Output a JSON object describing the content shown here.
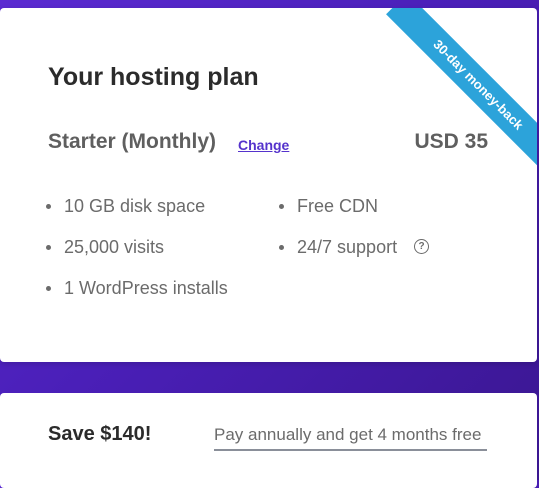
{
  "plan_card": {
    "ribbon_text": "30-day money-back",
    "title": "Your hosting plan",
    "plan_name": "Starter (Monthly)",
    "change_label": "Change",
    "price": "USD 35",
    "features_col1": [
      "10 GB disk space",
      "25,000 visits",
      "1 WordPress installs"
    ],
    "features_col2": [
      "Free CDN",
      "24/7 support"
    ],
    "help_icon": "question-circle"
  },
  "save_card": {
    "title": "Save $140!",
    "annual_link": "Pay annually and get 4 months free"
  },
  "colors": {
    "background": "#5b2bd1",
    "ribbon": "#2ca3da",
    "link": "#5533cc"
  }
}
